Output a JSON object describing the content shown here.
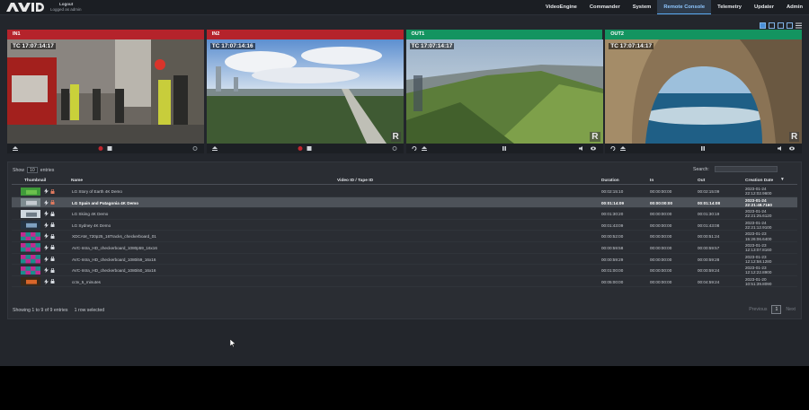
{
  "header": {
    "login_line1": "Logout",
    "login_line2": "Logged as admin",
    "nav": [
      {
        "label": "VideoEngine",
        "active": false
      },
      {
        "label": "Commander",
        "active": false
      },
      {
        "label": "System",
        "active": false
      },
      {
        "label": "Remote Console",
        "active": true
      },
      {
        "label": "Telemetry",
        "active": false
      },
      {
        "label": "Updater",
        "active": false
      },
      {
        "label": "Admin",
        "active": false
      }
    ]
  },
  "colors": {
    "input_header": "#b5232b",
    "output_header": "#139460",
    "accent": "#5aaaf2"
  },
  "panels": [
    {
      "id": "IN1",
      "timecode": "TC 17:07:14:17",
      "type": "input"
    },
    {
      "id": "IN2",
      "timecode": "TC 17:07:14:16",
      "type": "input"
    },
    {
      "id": "OUT1",
      "timecode": "TC 17:07:14:17",
      "type": "output"
    },
    {
      "id": "OUT2",
      "timecode": "TC 17:07:14:17",
      "type": "output"
    }
  ],
  "overlay_mark": "R",
  "table": {
    "show_label": "Show",
    "entries_value": "10",
    "entries_label": "entries",
    "search_label": "Search:",
    "columns": {
      "thumbnail": "Thumbnail",
      "name": "Name",
      "video_id": "Video ID / Tape ID",
      "duration": "Duration",
      "in": "In",
      "out": "Out",
      "creation_date": "Creation Date"
    },
    "rows": [
      {
        "name": "LG Story of Earth 4K Demo",
        "duration": "00:02:15:10",
        "in": "00:00:00:00",
        "out": "00:02:15:09",
        "date1": "2023-01-24",
        "date2": "22:12:02.9600",
        "selected": false
      },
      {
        "name": "LG Spain and Patagonia 4K Demo",
        "duration": "00:01:14:09",
        "in": "00:00:00:00",
        "out": "00:01:14:08",
        "date1": "2023-01-24",
        "date2": "22:21:48.7160",
        "selected": true
      },
      {
        "name": "LG Skiing 4K Demo",
        "duration": "00:01:30:20",
        "in": "00:00:00:00",
        "out": "00:01:30:19",
        "date1": "2023-01-24",
        "date2": "22:21:25.6120",
        "selected": false
      },
      {
        "name": "LG Sydney 4K Demo",
        "duration": "00:01:43:09",
        "in": "00:00:00:00",
        "out": "00:01:43:08",
        "date1": "2023-01-24",
        "date2": "22:21:12.9100",
        "selected": false
      },
      {
        "name": "XDCAM_720p25_16Tracks_checkerboard_01",
        "duration": "00:00:52:00",
        "in": "00:00:00:00",
        "out": "00:00:51:24",
        "date1": "2023-01-23",
        "date2": "15:26:06.6400",
        "selected": false
      },
      {
        "name": "AVC-Intra_HD_checkerboard_1080p59_16x16",
        "duration": "00:00:59:58",
        "in": "00:00:00:00",
        "out": "00:00:59:57",
        "date1": "2023-01-23",
        "date2": "12:13:07.8160",
        "selected": false
      },
      {
        "name": "AVC-Intra_HD_checkerboard_1080i59_16x16",
        "duration": "00:00:59:29",
        "in": "00:00:00:00",
        "out": "00:00:59:28",
        "date1": "2023-01-23",
        "date2": "12:12:58.1280",
        "selected": false
      },
      {
        "name": "AVC-Intra_HD_checkerboard_1080i50_16x16",
        "duration": "00:01:00:00",
        "in": "00:00:00:00",
        "out": "00:00:59:24",
        "date1": "2023-01-23",
        "date2": "12:12:22.8900",
        "selected": false
      },
      {
        "name": "cctv_5_minutes",
        "duration": "00:05:00:00",
        "in": "00:00:00:00",
        "out": "00:04:59:24",
        "date1": "2023-01-20",
        "date2": "10:51:39.8090",
        "selected": false
      }
    ],
    "info": "Showing 1 to 9 of 9 entries",
    "selection_info": "1 row selected",
    "pager": {
      "prev": "Previous",
      "page": "1",
      "next": "Next"
    }
  }
}
